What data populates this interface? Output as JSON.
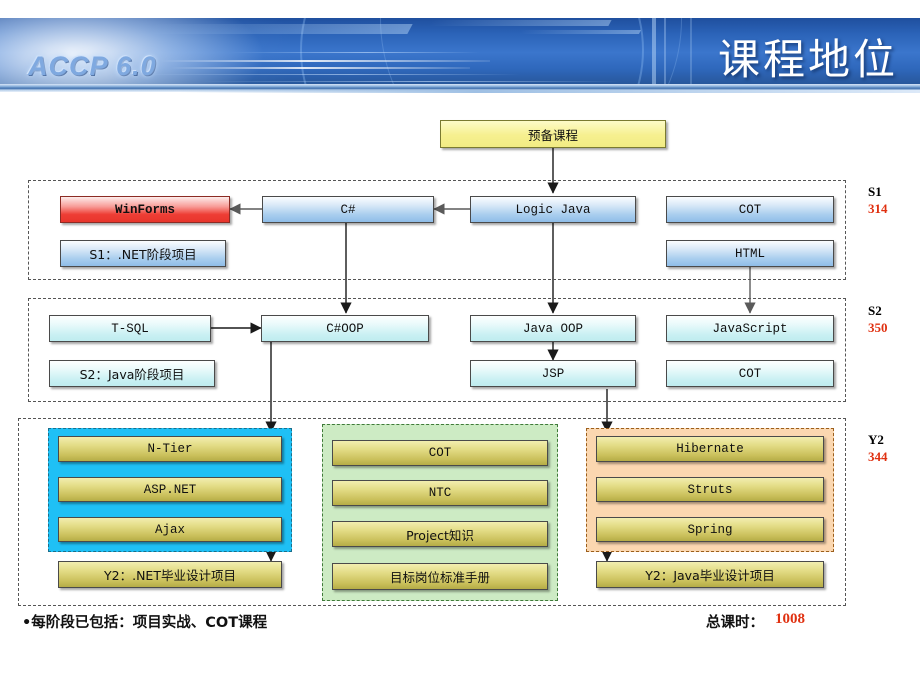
{
  "header": {
    "logo": "ACCP 6.0",
    "title": "课程地位",
    "accent_blue": "#2b63b8",
    "title_color": "#ffffff"
  },
  "diagram": {
    "prep_course": {
      "label": "预备课程",
      "style": "yellow"
    },
    "stages": [
      {
        "id": "S1",
        "label": "S1",
        "hours": "314"
      },
      {
        "id": "S2",
        "label": "S2",
        "hours": "350"
      },
      {
        "id": "Y2",
        "label": "Y2",
        "hours": "344"
      }
    ],
    "s1_nodes": [
      {
        "label": "WinForms",
        "style": "red"
      },
      {
        "label": "C#",
        "style": "blue"
      },
      {
        "label": "Logic Java",
        "style": "blue"
      },
      {
        "label": "COT",
        "style": "blue"
      },
      {
        "label": "S1：.NET阶段项目",
        "style": "blue"
      },
      {
        "label": "HTML",
        "style": "blue"
      }
    ],
    "s2_nodes": [
      {
        "label": "T-SQL",
        "style": "cyan"
      },
      {
        "label": "C#OOP",
        "style": "cyan"
      },
      {
        "label": "Java OOP",
        "style": "cyan"
      },
      {
        "label": "JavaScript",
        "style": "cyan"
      },
      {
        "label": "S2：Java阶段项目",
        "style": "cyan"
      },
      {
        "label": "JSP",
        "style": "cyan"
      },
      {
        "label": "COT",
        "style": "cyan"
      }
    ],
    "y2_group_net": {
      "bg_color": "#1fc0f5",
      "nodes": [
        {
          "label": "N-Tier",
          "style": "olive"
        },
        {
          "label": "ASP.NET",
          "style": "olive"
        },
        {
          "label": "Ajax",
          "style": "olive"
        }
      ],
      "project": {
        "label": "Y2：.NET毕业设计项目",
        "style": "olive"
      }
    },
    "y2_group_common": {
      "bg_color": "#cdebc4",
      "nodes": [
        {
          "label": "COT",
          "style": "olive"
        },
        {
          "label": "NTC",
          "style": "olive"
        },
        {
          "label": "Project知识",
          "style": "olive"
        },
        {
          "label": "目标岗位标准手册",
          "style": "olive"
        }
      ]
    },
    "y2_group_java": {
      "bg_color": "#fbd7b0",
      "nodes": [
        {
          "label": "Hibernate",
          "style": "olive"
        },
        {
          "label": "Struts",
          "style": "olive"
        },
        {
          "label": "Spring",
          "style": "olive"
        }
      ],
      "project": {
        "label": "Y2：Java毕业设计项目",
        "style": "olive"
      }
    }
  },
  "footer": {
    "note": "•每阶段已包括：项目实战、COT课程",
    "total_label": "总课时：",
    "total_value": "1008",
    "total_color": "#e03010"
  }
}
